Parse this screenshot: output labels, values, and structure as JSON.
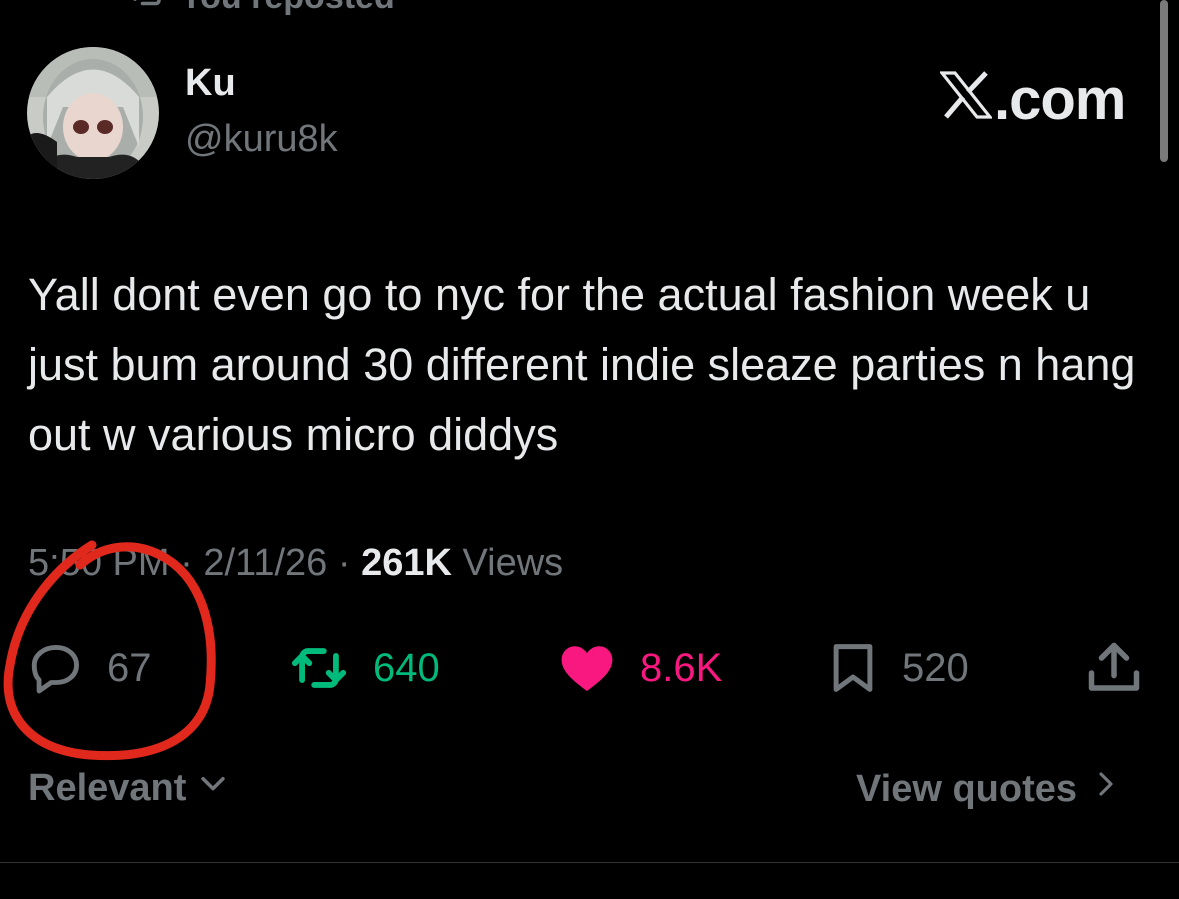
{
  "repost": {
    "label": "You reposted",
    "icon": "repost-icon"
  },
  "author": {
    "name": "Ku",
    "handle": "@kuru8k",
    "avatar_icon": "avatar"
  },
  "brand": {
    "domain_text": ".com",
    "logo_icon": "x-logo-icon"
  },
  "tweet": {
    "text": "Yall dont even go to nyc for the actual fashion week u just bum around 30 different indie sleaze parties n hang out w various micro diddys"
  },
  "meta": {
    "time": "5:50 PM",
    "sep1": " · ",
    "date": "2/11/26",
    "sep2": " · ",
    "views_count": "261K",
    "views_label": " Views"
  },
  "actions": {
    "replies": "67",
    "reposts": "640",
    "likes": "8.6K",
    "bookmarks": "520"
  },
  "footer": {
    "sort_label": "Relevant",
    "quotes_label": "View quotes"
  },
  "colors": {
    "repost": "#00ba7c",
    "like": "#f91880",
    "muted": "#71767b",
    "annotation": "#e0281d"
  }
}
